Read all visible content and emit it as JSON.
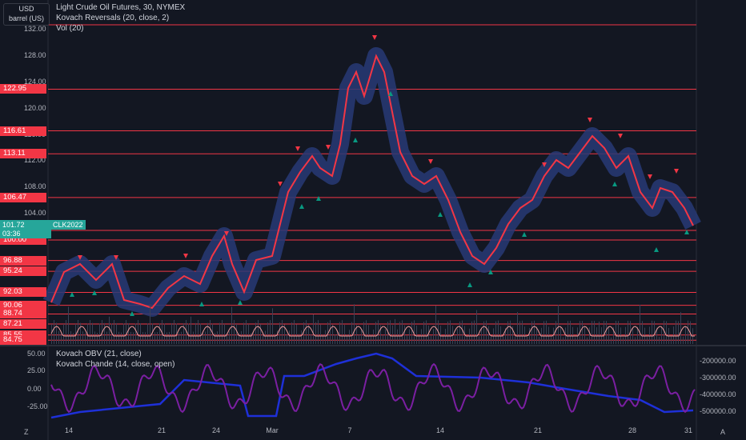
{
  "currency": {
    "top": "USD",
    "bottom": "barrel (US)"
  },
  "legend": {
    "symbol": "Light Crude Oil Futures, 30, NYMEX",
    "indicator1": "Kovach Reversals (20, close, 2)",
    "indicator2": "Vol (20)",
    "indicator3": "Kovach OBV (21, close)",
    "indicator4": "Kovach Chande (14, close, open)"
  },
  "price_axis": {
    "ticks": [
      "132.00",
      "128.00",
      "124.00",
      "120.00",
      "116.00",
      "112.00",
      "108.00",
      "104.00"
    ],
    "tags": [
      "122.95",
      "116.61",
      "113.11",
      "106.47",
      "101.46",
      "100.00",
      "96.88",
      "95.24",
      "92.03",
      "90.06",
      "88.74",
      "87.21",
      "85.55",
      "84.75"
    ],
    "last_price": "101.72",
    "countdown": "03:36",
    "symbol_tag": "CLK2022"
  },
  "osc_axis": {
    "left": [
      "50.00",
      "25.00",
      "0.00",
      "-25.00"
    ],
    "right": [
      "-200000.00",
      "-300000.00",
      "-400000.00",
      "-500000.00"
    ]
  },
  "x_axis": {
    "ticks": [
      "14",
      "21",
      "24",
      "Mar",
      "7",
      "14",
      "21",
      "28",
      "31"
    ]
  },
  "corner": {
    "left": "Z",
    "right": "A"
  },
  "colors": {
    "bg": "#131722",
    "red": "#f23645",
    "green": "#089981",
    "blue": "#2962ff",
    "purple": "#9c27b0",
    "band": "#283a75"
  },
  "chart_data": {
    "type": "line",
    "title": "Light Crude Oil Futures, 30, NYMEX",
    "x": [
      "14",
      "21",
      "24",
      "Mar",
      "7",
      "14",
      "21",
      "28",
      "31"
    ],
    "series": [
      {
        "name": "Light Crude Oil Futures",
        "values": [
          93.5,
          91.0,
          95.0,
          106.0,
          125.0,
          100.0,
          112.5,
          104.5,
          101.72
        ]
      }
    ],
    "horizontal_levels": [
      122.95,
      116.61,
      113.11,
      106.47,
      101.46,
      100.0,
      96.88,
      95.24,
      92.03,
      90.06,
      88.74,
      87.21,
      85.55,
      84.75
    ],
    "ylim": [
      84.5,
      133.5
    ]
  }
}
